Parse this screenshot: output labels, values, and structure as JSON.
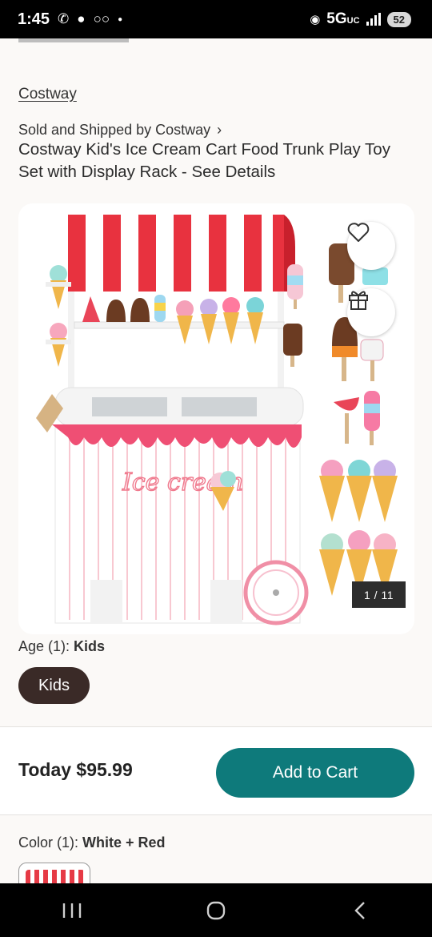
{
  "status_bar": {
    "time": "1:45",
    "network": "5G",
    "network_suffix": "UC",
    "battery": "52",
    "icons": [
      "missed-call-icon",
      "chat-bubble-icon",
      "voicemail-icon",
      "dot-icon",
      "hotspot-icon",
      "signal-icon",
      "battery-icon"
    ]
  },
  "product": {
    "brand": "Costway",
    "seller": "Sold and Shipped by Costway",
    "title": "Costway Kid's Ice Cream Cart Food Trunk Play Toy Set with Display Rack - See Details",
    "image_counter": "1 / 11",
    "image_text": "Ice cream"
  },
  "age": {
    "label": "Age (1):",
    "value": "Kids",
    "chip": "Kids"
  },
  "buy_bar": {
    "price": "Today $95.99",
    "cart_button": "Add to Cart"
  },
  "color": {
    "label": "Color (1):",
    "value": "White + Red"
  },
  "colors": {
    "accent": "#0e7a7b",
    "chip": "#3a2a27",
    "stripe_red": "#e63a45",
    "drip_pink": "#ef4f74"
  },
  "nav_icons": [
    "recent-apps-icon",
    "home-icon",
    "back-icon"
  ]
}
